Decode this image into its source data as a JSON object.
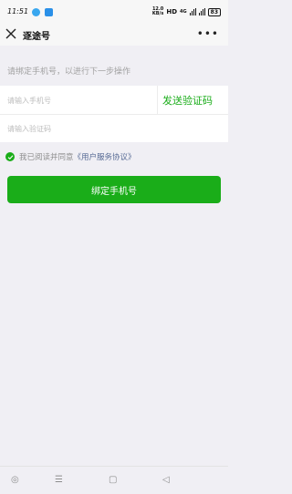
{
  "status_bar": {
    "time": "11:51",
    "net_speed_value": "12.0",
    "net_speed_unit": "KB/s",
    "network": "HD",
    "signal_label": "4G",
    "battery": "83"
  },
  "navbar": {
    "title": "逐途号"
  },
  "hint": "请绑定手机号，以进行下一步操作",
  "form": {
    "phone_placeholder": "请输入手机号",
    "code_placeholder": "请输入验证码",
    "send_code_label": "发送验证码"
  },
  "agreement": {
    "text": "我已阅读并同意",
    "link": "《用户服务协议》"
  },
  "bind_button_label": "绑定手机号",
  "colors": {
    "accent": "#1aad19",
    "link": "#576b95",
    "background": "#f0eff4"
  }
}
